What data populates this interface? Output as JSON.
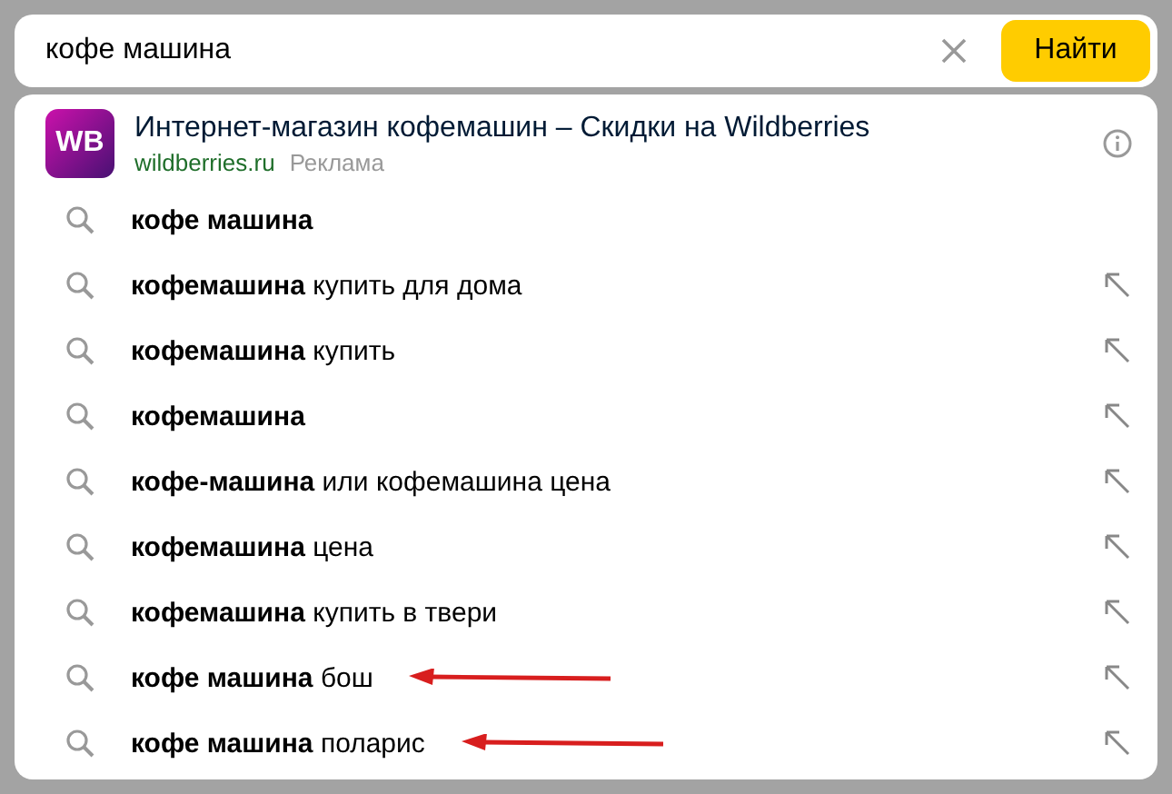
{
  "search": {
    "value": "кофе машина",
    "button": "Найти"
  },
  "ad": {
    "logo": "WB",
    "title": "Интернет-магазин кофемашин – Скидки на Wildberries",
    "domain": "wildberries.ru",
    "label": "Реклама"
  },
  "suggestions": [
    {
      "kind": "typed",
      "match": "кофе машина",
      "annotated": false
    },
    {
      "kind": "suggestion",
      "match": "кофемашина",
      "rest": "купить для дома",
      "annotated": false
    },
    {
      "kind": "suggestion",
      "match": "кофемашина",
      "rest": "купить",
      "annotated": false
    },
    {
      "kind": "suggestion",
      "match": "кофемашина",
      "annotated": false
    },
    {
      "kind": "suggestion",
      "match": "кофе-машина",
      "rest": "или кофемашина цена",
      "annotated": false
    },
    {
      "kind": "suggestion",
      "match": "кофемашина",
      "rest": "цена",
      "annotated": false
    },
    {
      "kind": "suggestion",
      "match": "кофемашина",
      "rest": "купить в твери",
      "annotated": false
    },
    {
      "kind": "suggestion",
      "match": "кофе машина",
      "rest": "бош",
      "annotated": true
    },
    {
      "kind": "suggestion",
      "match": "кофе машина",
      "rest": "поларис",
      "annotated": true
    }
  ]
}
